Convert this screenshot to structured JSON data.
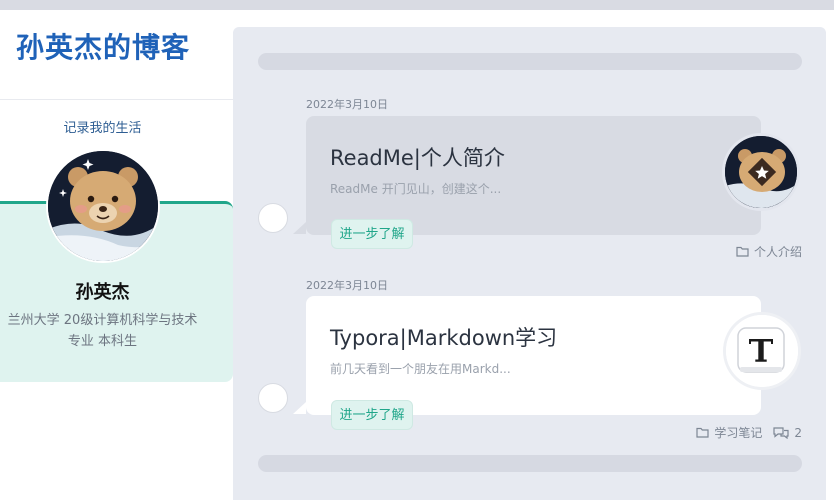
{
  "site": {
    "title": "孙英杰的博客",
    "tagline": "记录我的生活"
  },
  "profile": {
    "name": "孙英杰",
    "desc_line1": "兰州大学 20级计算机科学与技术",
    "desc_line2": "专业 本科生"
  },
  "posts": [
    {
      "date": "2022年3月10日",
      "title": "ReadMe|个人简介",
      "excerpt": "ReadMe 开门见山，创建这个...",
      "more_label": "进一步了解",
      "category": "个人介绍",
      "thumb_icon": "bear-star-icon"
    },
    {
      "date": "2022年3月10日",
      "title": "Typora|Markdown学习",
      "excerpt": "前几天看到一个朋友在用Markd...",
      "more_label": "进一步了解",
      "category": "学习笔记",
      "comments": "2",
      "thumb_icon": "typora-logo-icon"
    }
  ],
  "colors": {
    "title_blue": "#1f62b8",
    "accent_green": "#20a68a",
    "card_mint": "#dff3ef",
    "main_bg": "#e7eaf1",
    "bubble_gray": "#d8dbe3"
  }
}
